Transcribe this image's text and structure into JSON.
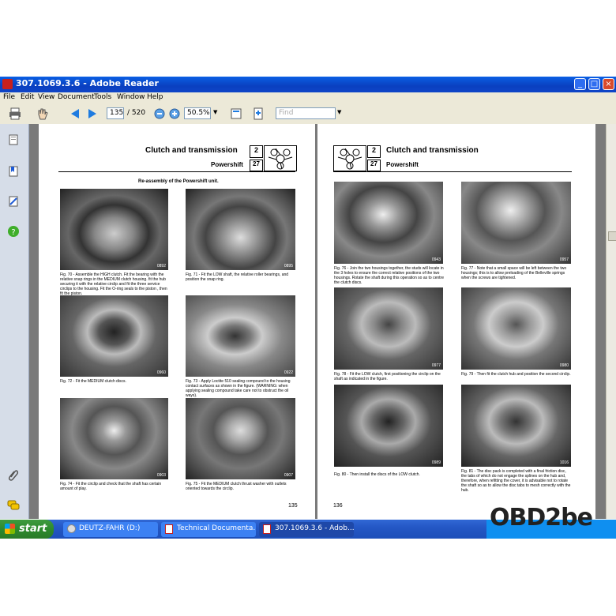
{
  "window": {
    "title": "307.1069.3.6  - Adobe Reader",
    "min_label": "_",
    "max_label": "□",
    "close_label": "×"
  },
  "menu": [
    "File",
    "Edit",
    "View",
    "Document",
    "Tools",
    "Window",
    "Help"
  ],
  "toolbar": {
    "page_current": "135",
    "page_total": "/ 520",
    "zoom": "50.5%",
    "find_placeholder": "Find"
  },
  "left_page": {
    "chapter_title": "Clutch and transmission",
    "chapter_num": "2",
    "section_title": "Powershift",
    "section_num": "27",
    "heading": "Re-assembly of the Powershift unit.",
    "page_number": "135",
    "figures": [
      {
        "num": "0892",
        "caption": "Fig. 70 - Assemble the HIGH clutch. Fit the bearing with the relative snap rings in the MEDIUM clutch housing. fit the hub securing it with the relative circlip and fit the three service circlips to the housing. Fit the O-ring seals to the piston , then fit the piston."
      },
      {
        "num": "0895",
        "caption": "Fig. 71 - Fit the LOW shaft, the relative roller bearings, and position the snap ring."
      },
      {
        "num": "0960",
        "caption": "Fig. 72 - Fit the MEDIUM clutch discs."
      },
      {
        "num": "0922",
        "caption": "Fig. 73 - Apply Loctite 510 sealing compound to the housing contact surfaces as shown in the figure. (WARNING: when applying sealing compound take care not to obstruct the oil ways)."
      },
      {
        "num": "0903",
        "caption": "Fig. 74 - Fit the circlip and check that the shaft has certain amount of play."
      },
      {
        "num": "0907",
        "caption": "Fig. 75 - Fit the MEDIUM clutch thrust washer with outlets oriented towards the circlip."
      }
    ]
  },
  "right_page": {
    "chapter_title": "Clutch and transmission",
    "chapter_num": "2",
    "section_title": "Powershift",
    "section_num": "27",
    "page_number": "136",
    "figures": [
      {
        "num": "0943",
        "caption": "Fig. 76 - Join the two housings together, the studs will locate in the 3 holes to ensure the correct relative positions of the two housings. Rotate the shaft during this operation so as to centre the clutch discs."
      },
      {
        "num": "0957",
        "caption": "Fig. 77 - Note that a small space will be left between the two housings; this is to allow preloading of the Belleville springs when the screws are tightened."
      },
      {
        "num": "0977",
        "caption": "Fig. 78 - Fit the LOW clutch, first positioning the circlip on the shaft as indicated in the figure."
      },
      {
        "num": "0980",
        "caption": "Fig. 79 - Then fit the clutch hub and position the second circlip."
      },
      {
        "num": "0989",
        "caption": "Fig. 80 - Then install the discs of the LOW clutch."
      },
      {
        "num": "1016",
        "caption": "Fig. 81 - The disc pack is completed with a final friction disc, the tabs of which do not engage the splines on the hub and, therefore, when refitting the cover, it is advisable not to rotate the shaft so as to allow the disc tabs to mesh correctly with the hub."
      }
    ]
  },
  "taskbar": {
    "start_label": "start",
    "tasks": [
      "DEUTZ-FAHR (D:)",
      "Technical Documenta...",
      "307.1069.3.6 - Adob..."
    ],
    "watermark": "OBD2be"
  }
}
